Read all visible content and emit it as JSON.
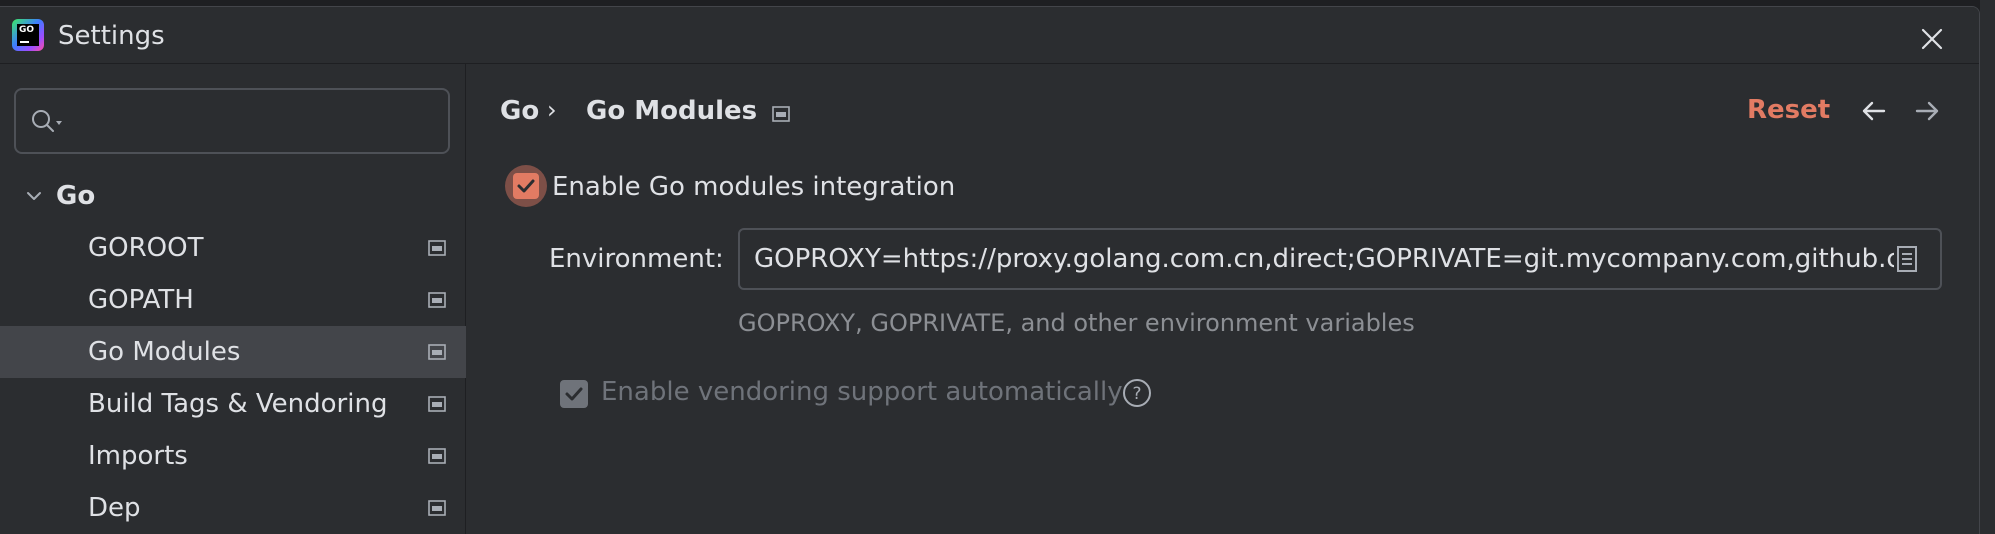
{
  "window": {
    "title": "Settings"
  },
  "app_logo": {
    "text": "GO"
  },
  "sidebar": {
    "search": {
      "placeholder": "",
      "value": ""
    },
    "group": {
      "label": "Go",
      "expanded": true
    },
    "items": [
      {
        "label": "GOROOT",
        "selected": false
      },
      {
        "label": "GOPATH",
        "selected": false
      },
      {
        "label": "Go Modules",
        "selected": true
      },
      {
        "label": "Build Tags & Vendoring",
        "selected": false
      },
      {
        "label": "Imports",
        "selected": false
      },
      {
        "label": "Dep",
        "selected": false
      }
    ]
  },
  "header": {
    "breadcrumb": [
      "Go",
      "Go Modules"
    ],
    "breadcrumb_separator": "›",
    "reset_label": "Reset"
  },
  "content": {
    "modules_checkbox": {
      "label": "Enable Go modules integration",
      "checked": true
    },
    "environment": {
      "label": "Environment:",
      "value": "GOPROXY=https://proxy.golang.com.cn,direct;GOPRIVATE=git.mycompany.com,github.com/my/private",
      "hint": "GOPROXY, GOPRIVATE, and other environment variables"
    },
    "vendoring_checkbox": {
      "label": "Enable vendoring support automatically",
      "checked": true,
      "enabled": false
    }
  },
  "colors": {
    "accent": "#e27b63",
    "background": "#2b2d30",
    "selection": "#43454a",
    "text": "#dfe1e5",
    "muted_text": "#8c8f94"
  }
}
